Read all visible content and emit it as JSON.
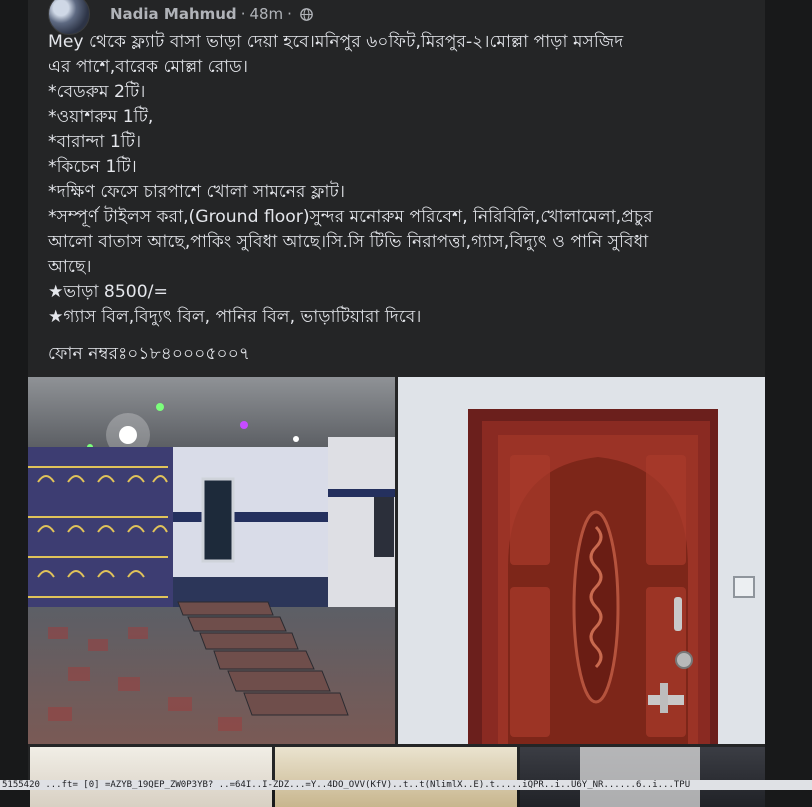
{
  "post": {
    "author": "Nadia Mahmud",
    "separator": "·",
    "time": "48m",
    "audience_icon": "globe-icon",
    "lines": [
      "Mey থেকে ফ্ল্যাট বাসা ভাড়া দেয়া হবে।মনিপুর ৬০ফিট,মিরপুর-২।মোল্লা পাড়া মসজিদ",
      "এর পাশে,বারেক মোল্লা রোড।",
      "*বেডরুম 2টি।",
      "*ওয়াশরুম 1টি,",
      "*বারান্দা 1টি।",
      "*কিচেন 1টি।",
      "*দক্ষিণ ফেসে চারপাশে খোলা সামনের ফ্লাট।",
      "*সম্পূর্ণ টাইলস করা,(Ground floor)সুন্দর মনোরুম পরিবেশ, নিরিবিলি,খোলামেলা,প্রচুর",
      "আলো বাতাস আছে,পাকিং সুবিধা আছে।সি.সি টিভি নিরাপত্তা,গ্যাস,বিদ্যুৎ ও পানি সুবিধা",
      "আছে।",
      "★ভাড়া 8500/=",
      "★গ্যাস বিল,বিদ্যুৎ বিল, পানির বিল, ভাড়াটিয়ারা দিবে।"
    ],
    "phone": "ফোন নম্বরঃ০১৮৪০০০৫০০৭"
  },
  "photos": [
    {
      "name": "entrance-photo",
      "description_icon": "photo-entrance"
    },
    {
      "name": "door-photo",
      "description_icon": "photo-door"
    },
    {
      "name": "room-photo-1",
      "description_icon": "photo-room"
    },
    {
      "name": "room-photo-2",
      "description_icon": "photo-room"
    },
    {
      "name": "room-photo-3",
      "description_icon": "photo-room"
    }
  ],
  "status_url": "5155420 ...ft= [0] =AZYB_19QEP_ZW0P3YB? ..=64I..I-ZDZ...=Y..4DO_OVV(KfV)..t..t(NlimlX..E).t.....iQPR..i..U6Y_NR......6..i...TPU",
  "colors": {
    "page_bg": "#18191a",
    "card_bg": "#242526",
    "text_primary": "#e4e6eb",
    "text_secondary": "#b0b3b8"
  }
}
